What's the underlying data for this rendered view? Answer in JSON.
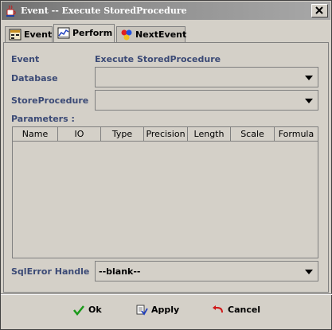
{
  "window": {
    "title": "Event -- Execute StoredProcedure",
    "close_icon": "close-icon",
    "app_icon": "java-cup-icon"
  },
  "tabs": [
    {
      "label": "Event",
      "icon": "event-grid-icon",
      "active": false
    },
    {
      "label": "Perform",
      "icon": "chart-icon",
      "active": true
    },
    {
      "label": "NextEvent",
      "icon": "balls-icon",
      "active": false
    }
  ],
  "form": {
    "event_label": "Event",
    "event_value": "Execute StoredProcedure",
    "database_label": "Database",
    "database_value": "",
    "storeprocedure_label": "StoreProcedure",
    "storeprocedure_value": "",
    "parameters_label": "Parameters :",
    "sqlerror_label": "SqlError Handle",
    "sqlerror_value": "--blank--"
  },
  "parameters_table": {
    "columns": [
      "Name",
      "IO",
      "Type",
      "Precision",
      "Length",
      "Scale",
      "Formula"
    ],
    "rows": []
  },
  "buttons": {
    "ok_label": "Ok",
    "apply_label": "Apply",
    "cancel_label": "Cancel"
  },
  "colors": {
    "label_color": "#3b4a76",
    "ok_check": "#1a9a1a",
    "cancel_arrow": "#d01818"
  }
}
